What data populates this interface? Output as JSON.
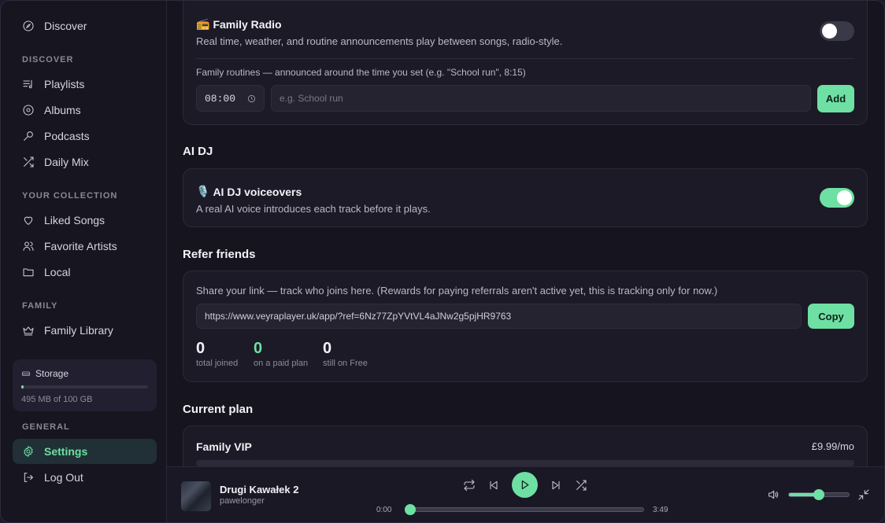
{
  "sidebar": {
    "top_item": "Discover",
    "sections": {
      "discover": "DISCOVER",
      "collection": "YOUR COLLECTION",
      "family": "FAMILY",
      "general": "GENERAL"
    },
    "items": {
      "playlists": "Playlists",
      "albums": "Albums",
      "podcasts": "Podcasts",
      "daily_mix": "Daily Mix",
      "liked_songs": "Liked Songs",
      "favorite_artists": "Favorite Artists",
      "local": "Local",
      "family_library": "Family Library",
      "settings": "Settings",
      "log_out": "Log Out"
    },
    "storage": {
      "label": "Storage",
      "usage": "495 MB of 100 GB",
      "fraction": 0.005
    }
  },
  "family_radio": {
    "emoji": "📻",
    "title": "Family Radio",
    "description": "Real time, weather, and routine announcements play between songs, radio-style.",
    "enabled": false,
    "routines_label": "Family routines — announced around the time you set (e.g. \"School run\", 8:15)",
    "time_value": "08:00",
    "name_placeholder": "e.g. School run",
    "add_label": "Add"
  },
  "ai_dj": {
    "heading": "AI DJ",
    "emoji": "🎙️",
    "title": "AI DJ voiceovers",
    "description": "A real AI voice introduces each track before it plays.",
    "enabled": true
  },
  "refer": {
    "heading": "Refer friends",
    "description": "Share your link — track who joins here. (Rewards for paying referrals aren't active yet, this is tracking only for now.)",
    "link": "https://www.veyraplayer.uk/app/?ref=6Nz77ZpYVtVL4aJNw2g5pjHR9763",
    "copy_label": "Copy",
    "stats": [
      {
        "value": "0",
        "label": "total joined"
      },
      {
        "value": "0",
        "label": "on a paid plan"
      },
      {
        "value": "0",
        "label": "still on Free"
      }
    ]
  },
  "plan": {
    "heading": "Current plan",
    "name": "Family VIP",
    "price": "£9.99/mo"
  },
  "player": {
    "track_title": "Drugi Kawałek 2",
    "artist": "pawelonger",
    "elapsed": "0:00",
    "duration": "3:49",
    "progress": 0.0,
    "volume": 0.5
  },
  "colors": {
    "accent": "#6ee0a3",
    "background": "#16141f",
    "card": "#1c1a26"
  }
}
